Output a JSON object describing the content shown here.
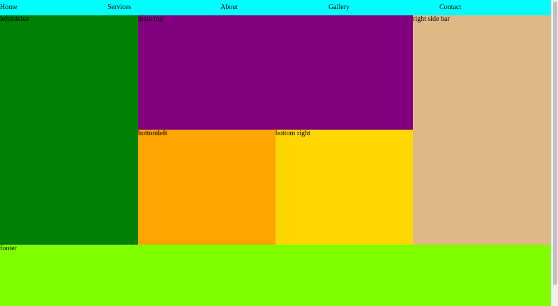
{
  "nav": {
    "items": [
      "Home",
      "Services",
      "About",
      "Gallery",
      "Contact"
    ]
  },
  "panels": {
    "left_sidebar": "leftsidebar",
    "main_top": "main top",
    "bottom_left": "bottomleft",
    "bottom_right": "bottom right",
    "right_sidebar": "right side bar",
    "footer": "footer"
  },
  "colors": {
    "nav": "#00ffff",
    "left_sidebar": "#008000",
    "main_top": "#800080",
    "bottom_left": "#ffa500",
    "bottom_right": "#ffd700",
    "right_sidebar": "#deb887",
    "footer": "#7fff00"
  }
}
